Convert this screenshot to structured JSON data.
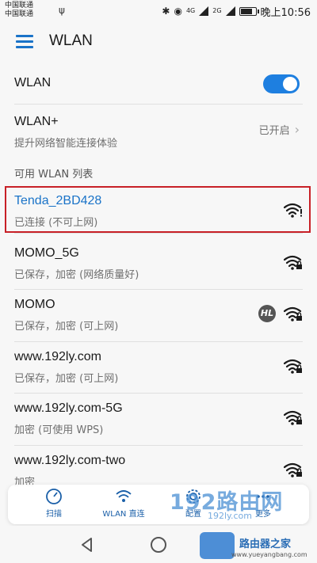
{
  "status_bar": {
    "carrier_1": "中国联通",
    "carrier_2": "中国联通",
    "usb": "ψ",
    "bluetooth": "✱",
    "eye": "◉",
    "signal_1": "4G",
    "signal_2": "2G",
    "time": "晚上10:56",
    "battery_level": 0.85
  },
  "app_bar": {
    "title": "WLAN",
    "menu_icon": "menu-icon"
  },
  "wlan_toggle": {
    "label": "WLAN",
    "on": true
  },
  "wlan_plus": {
    "title": "WLAN+",
    "subtitle": "提升网络智能连接体验",
    "status": "已开启",
    "chevron": "›"
  },
  "section_header": "可用 WLAN 列表",
  "networks": [
    {
      "ssid": "Tenda_2BD428",
      "status": "已连接 (不可上网)",
      "locked": false,
      "warning": true,
      "connected": true
    },
    {
      "ssid": "MOMO_5G",
      "status": "已保存，加密 (网络质量好)",
      "locked": true
    },
    {
      "ssid": "MOMO",
      "status": "已保存，加密 (可上网)",
      "locked": true,
      "badge": "HL"
    },
    {
      "ssid": "www.192ly.com",
      "status": "已保存，加密 (可上网)",
      "locked": true
    },
    {
      "ssid": "www.192ly.com-5G",
      "status": "加密 (可使用 WPS)",
      "locked": true
    },
    {
      "ssid": "www.192ly.com-two",
      "status": "加密",
      "locked": true
    }
  ],
  "float_bar": {
    "scan": "扫描",
    "wlan_direct": "WLAN 直连",
    "config": "配置",
    "more": "更多"
  },
  "watermark": {
    "big": "192路由网",
    "small": "192ly.com",
    "brand": "路由器之家",
    "url": "www.yueyangbang.com"
  },
  "colors": {
    "accent": "#1e7fe0",
    "connected_text": "#1a73c8",
    "highlight_box": "#c82027"
  }
}
